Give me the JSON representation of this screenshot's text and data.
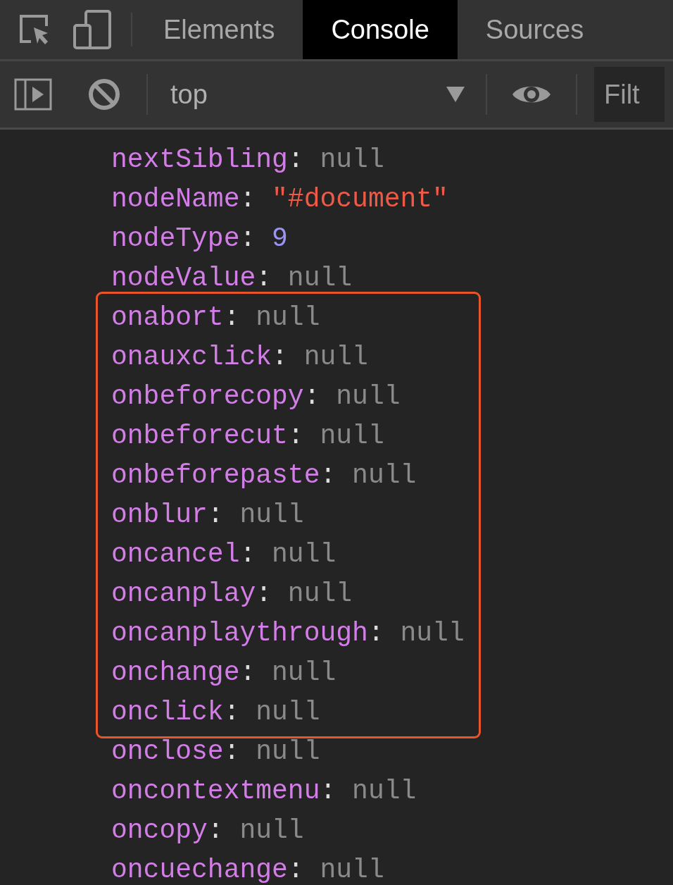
{
  "tabs": [
    {
      "label": "Elements",
      "selected": false
    },
    {
      "label": "Console",
      "selected": true
    },
    {
      "label": "Sources",
      "selected": false
    }
  ],
  "toolbar": {
    "context": "top",
    "filter": {
      "placeholder": "Filt"
    }
  },
  "groups": [
    {
      "highlighted": false,
      "properties": [
        {
          "name": "nextSibling:",
          "value": "null",
          "kind": "null"
        },
        {
          "name": "nodeName:",
          "value": "\"#document\"",
          "kind": "string"
        },
        {
          "name": "nodeType:",
          "value": "9",
          "kind": "number"
        },
        {
          "name": "nodeValue:",
          "value": "null",
          "kind": "null"
        }
      ]
    },
    {
      "highlighted": true,
      "properties": [
        {
          "name": "onabort:",
          "value": "null",
          "kind": "null"
        },
        {
          "name": "onauxclick:",
          "value": "null",
          "kind": "null"
        },
        {
          "name": "onbeforecopy:",
          "value": "null",
          "kind": "null"
        },
        {
          "name": "onbeforecut:",
          "value": "null",
          "kind": "null"
        },
        {
          "name": "onbeforepaste:",
          "value": "null",
          "kind": "null"
        },
        {
          "name": "onblur:",
          "value": "null",
          "kind": "null"
        },
        {
          "name": "oncancel:",
          "value": "null",
          "kind": "null"
        },
        {
          "name": "oncanplay:",
          "value": "null",
          "kind": "null"
        },
        {
          "name": "oncanplaythrough:",
          "value": "null",
          "kind": "null"
        },
        {
          "name": "onchange:",
          "value": "null",
          "kind": "null"
        },
        {
          "name": "onclick:",
          "value": "null",
          "kind": "null"
        }
      ]
    },
    {
      "highlighted": false,
      "properties": [
        {
          "name": "onclose:",
          "value": "null",
          "kind": "null"
        },
        {
          "name": "oncontextmenu:",
          "value": "null",
          "kind": "null"
        },
        {
          "name": "oncopy:",
          "value": "null",
          "kind": "null"
        },
        {
          "name": "oncuechange:",
          "value": "null",
          "kind": "null"
        }
      ]
    }
  ]
}
